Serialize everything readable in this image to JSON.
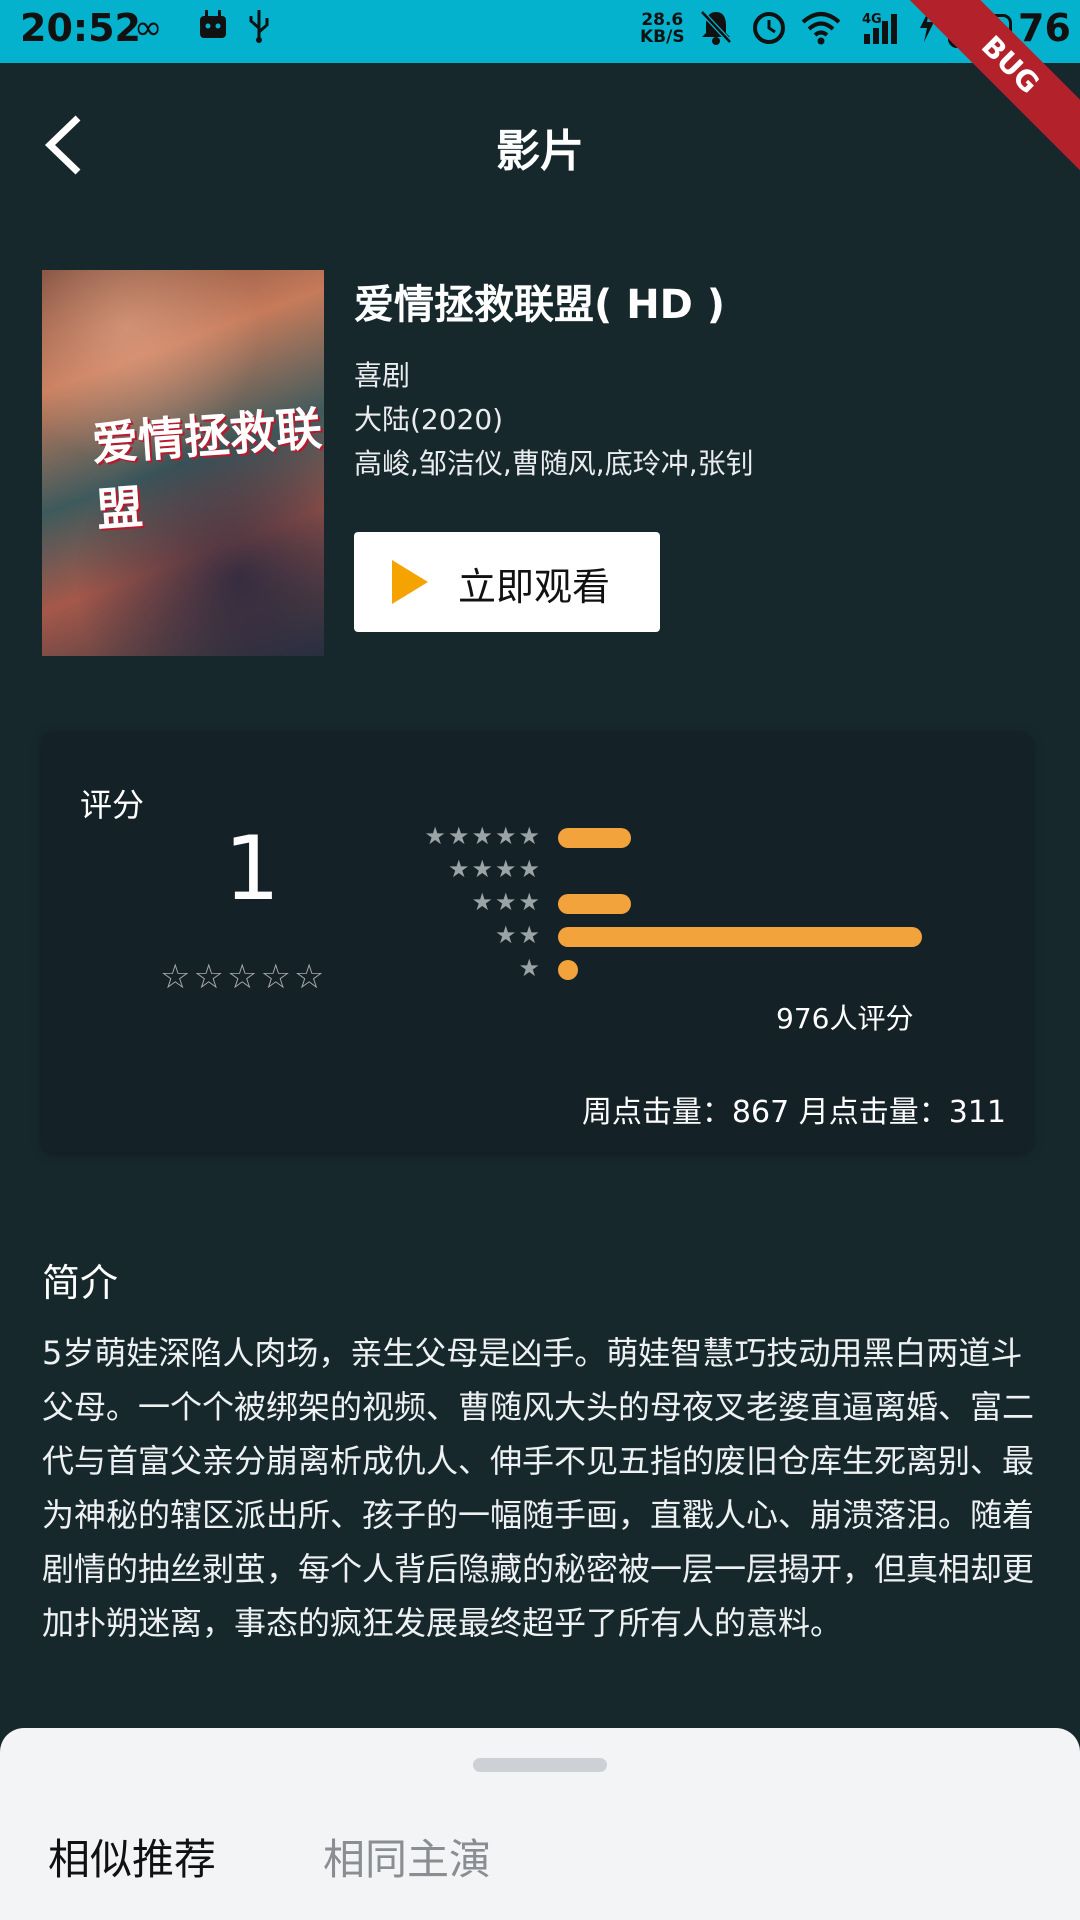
{
  "status_bar": {
    "time": "20:52",
    "speed_value": "28.6",
    "speed_unit": "KB/S",
    "net_type": "4G",
    "battery": "76",
    "icons": [
      "infinity-icon",
      "android-icon",
      "usb-icon",
      "mute-icon",
      "alarm-icon",
      "wifi-icon",
      "signal-icon",
      "charging-icon",
      "battery-icon"
    ]
  },
  "appbar": {
    "title": "影片",
    "debug_ribbon": "BUG"
  },
  "movie": {
    "poster_text": "爱情拯救联盟",
    "title": "爱情拯救联盟( HD )",
    "genre": "喜剧",
    "region_year": "大陆(2020)",
    "cast": "高峻,邹洁仪,曹随风,底玲冲,张钊",
    "watch_label": "立即观看"
  },
  "rating": {
    "label": "评分",
    "score": "1",
    "score_stars": "☆☆☆☆☆",
    "distribution": [
      {
        "stars": "★★★★★",
        "fraction": 0.2
      },
      {
        "stars": "★★★★",
        "fraction": 0.0
      },
      {
        "stars": "★★★",
        "fraction": 0.2
      },
      {
        "stars": "★★",
        "fraction": 1.0
      },
      {
        "stars": "★",
        "fraction": 0.05
      }
    ],
    "count_text": "976人评分",
    "click_stats": "周点击量：867  月点击量：311"
  },
  "synopsis": {
    "title": "简介",
    "text": "5岁萌娃深陷人肉场，亲生父母是凶手。萌娃智慧巧技动用黑白两道斗父母。一个个被绑架的视频、曹随风大头的母夜叉老婆直逼离婚、富二代与首富父亲分崩离析成仇人、伸手不见五指的废旧仓库生死离别、最为神秘的辖区派出所、孩子的一幅随手画，直戳人心、崩溃落泪。随着剧情的抽丝剥茧，每个人背后隐藏的秘密被一层一层揭开，但真相却更加扑朔迷离，事态的疯狂发展最终超乎了所有人的意料。"
  },
  "bottom_sheet": {
    "tabs": [
      {
        "label": "相似推荐",
        "active": true
      },
      {
        "label": "相同主演",
        "active": false
      }
    ]
  },
  "colors": {
    "accent": "#f3a33c",
    "status_bar": "#04b2cd",
    "background": "#17282d"
  }
}
